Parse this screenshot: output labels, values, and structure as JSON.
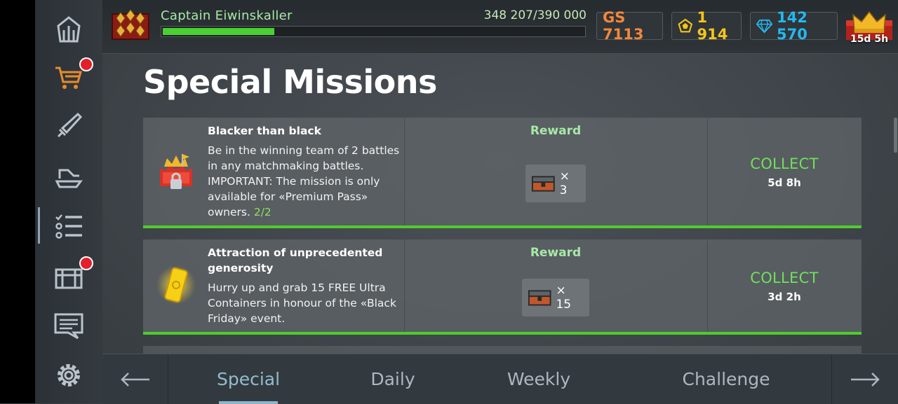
{
  "player": {
    "name": "Captain  Eiwinskaller",
    "xp_text": "348 207/390 000",
    "xp_progress": 0.27
  },
  "currencies": {
    "gs": "GS 7113",
    "gold": "1 914",
    "diamonds": "142 570",
    "premium_timer": "15d 5h"
  },
  "colors": {
    "accent_green": "#4ccd2c",
    "collect_green": "#6fe05a",
    "gs_orange": "#f3873a",
    "gold_yellow": "#f5c518",
    "diamond_blue": "#24b8f0",
    "notification_red": "#e3202a"
  },
  "sidebar": {
    "items": [
      {
        "icon": "hangar-icon",
        "badge": false
      },
      {
        "icon": "shop-cart-icon",
        "badge": true
      },
      {
        "icon": "weapon-icon",
        "badge": false
      },
      {
        "icon": "ships-icon",
        "badge": false
      },
      {
        "icon": "missions-list-icon",
        "badge": false,
        "active": true
      },
      {
        "icon": "containers-icon",
        "badge": true
      },
      {
        "icon": "messages-icon",
        "badge": false
      },
      {
        "icon": "settings-gear-icon",
        "badge": false
      }
    ]
  },
  "page": {
    "title": "Special Missions"
  },
  "missions": [
    {
      "title": "Blacker than black",
      "description": "Be in the winning team of 2 battles in any matchmaking battles. IMPORTANT: The mission is only available for «Premium Pass» owners.",
      "progress": "2/2",
      "reward_label": "Reward",
      "reward_qty": "× 3",
      "action": "COLLECT",
      "timer": "5d 8h"
    },
    {
      "title": "Attraction of unprecedented generosity",
      "description": "Hurry up and grab 15 FREE Ultra Containers in honour of the «Black Friday» event.",
      "reward_label": "Reward",
      "reward_qty": "× 15",
      "action": "COLLECT",
      "timer": "3d 2h"
    }
  ],
  "tabs": [
    {
      "label": "Special",
      "active": true
    },
    {
      "label": "Daily"
    },
    {
      "label": "Weekly"
    },
    {
      "label": "Challenge"
    }
  ]
}
